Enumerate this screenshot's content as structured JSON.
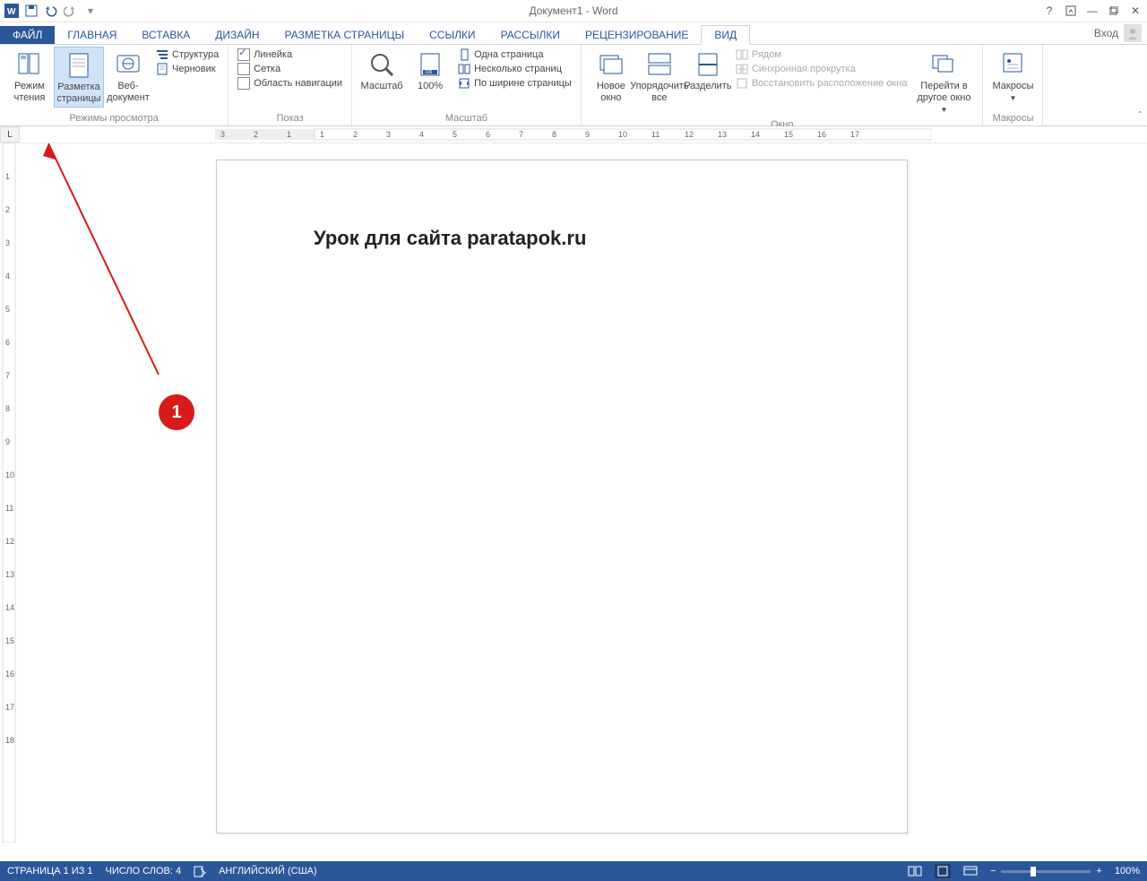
{
  "title": "Документ1 - Word",
  "qat": {
    "save": "save",
    "undo": "undo",
    "redo": "redo"
  },
  "signin_label": "Вход",
  "tabs": [
    "ФАЙЛ",
    "ГЛАВНАЯ",
    "ВСТАВКА",
    "ДИЗАЙН",
    "РАЗМЕТКА СТРАНИЦЫ",
    "ССЫЛКИ",
    "РАССЫЛКИ",
    "РЕЦЕНЗИРОВАНИЕ",
    "ВИД"
  ],
  "active_tab": "ВИД",
  "ribbon": {
    "views": {
      "label": "Режимы просмотра",
      "read": "Режим чтения",
      "layout": "Разметка страницы",
      "web": "Веб-документ",
      "outline": "Структура",
      "draft": "Черновик"
    },
    "show": {
      "label": "Показ",
      "ruler": "Линейка",
      "grid": "Сетка",
      "navpane": "Область навигации",
      "ruler_checked": true,
      "grid_checked": false,
      "nav_checked": false
    },
    "zoom": {
      "label": "Масштаб",
      "zoom": "Масштаб",
      "hundred": "100%",
      "one_page": "Одна страница",
      "multi_page": "Несколько страниц",
      "page_width": "По ширине страницы"
    },
    "window": {
      "label": "Окно",
      "new": "Новое окно",
      "arrange": "Упорядочить все",
      "split": "Разделить",
      "side": "Рядом",
      "sync": "Синхронная прокрутка",
      "reset": "Восстановить расположение окна",
      "switch": "Перейти в другое окно"
    },
    "macros": {
      "label": "Макросы",
      "btn": "Макросы"
    }
  },
  "document_text": "Урок для сайта paratapok.ru",
  "annotation": {
    "badge": "1"
  },
  "status": {
    "page": "СТРАНИЦА 1 ИЗ 1",
    "words": "ЧИСЛО СЛОВ: 4",
    "lang": "АНГЛИЙСКИЙ (США)",
    "zoom": "100%"
  },
  "ruler_h": [
    3,
    2,
    1,
    1,
    2,
    3,
    4,
    5,
    6,
    7,
    8,
    9,
    10,
    11,
    12,
    13,
    14,
    15,
    16,
    17
  ],
  "ruler_v": [
    1,
    2,
    3,
    4,
    5,
    6,
    7,
    8,
    9,
    10,
    11,
    12,
    13,
    14,
    15,
    16,
    17,
    18
  ]
}
